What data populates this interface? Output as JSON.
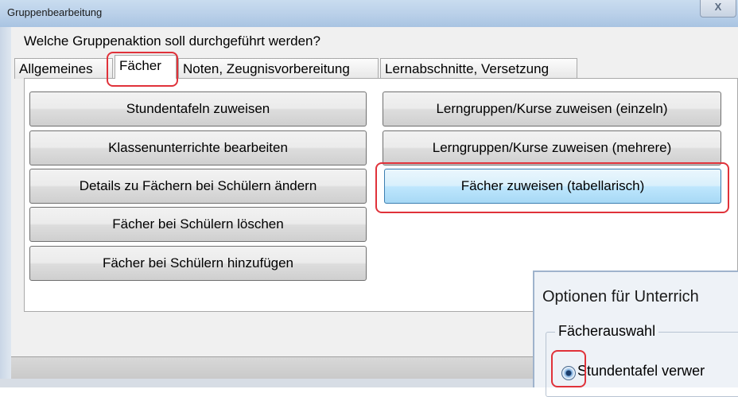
{
  "window": {
    "title": "Gruppenbearbeitung",
    "close_glyph": "X"
  },
  "prompt": "Welche Gruppenaktion soll durchgeführt werden?",
  "tabs": [
    {
      "label": "Allgemeines"
    },
    {
      "label": "Fächer"
    },
    {
      "label": "Noten, Zeugnisvorbereitung"
    },
    {
      "label": "Lernabschnitte, Versetzung"
    }
  ],
  "buttons_left": [
    {
      "label": "Stundentafeln zuweisen"
    },
    {
      "label": "Klassenunterrichte bearbeiten"
    },
    {
      "label": "Details zu Fächern bei Schülern ändern"
    },
    {
      "label": "Fächer bei Schülern löschen"
    },
    {
      "label": "Fächer bei Schülern hinzufügen"
    }
  ],
  "buttons_right": [
    {
      "label": "Lerngruppen/Kurse zuweisen (einzeln)"
    },
    {
      "label": "Lerngruppen/Kurse zuweisen (mehrere)"
    },
    {
      "label": "Fächer zuweisen (tabellarisch)"
    }
  ],
  "options_dialog": {
    "title": "Optionen für Unterrich",
    "group_label": "Fächerauswahl",
    "radio_label": "Stundentafel verwer",
    "radio_selected": true
  },
  "highlight_color": "#e0323a"
}
